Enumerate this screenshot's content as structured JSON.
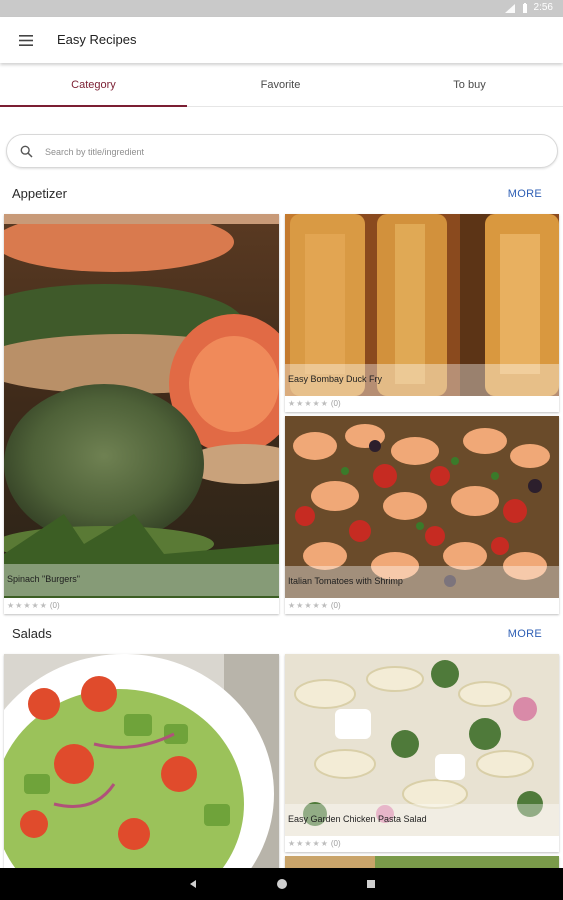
{
  "status": {
    "time": "2:56"
  },
  "app": {
    "title": "Easy Recipes"
  },
  "tabs": [
    {
      "label": "Category",
      "active": true
    },
    {
      "label": "Favorite",
      "active": false
    },
    {
      "label": "To buy",
      "active": false
    }
  ],
  "search": {
    "placeholder": "Search by title/ingredient",
    "value": ""
  },
  "sections": [
    {
      "title": "Appetizer",
      "more_label": "MORE",
      "recipes": [
        {
          "title": "Spinach \"Burgers\"",
          "rating_count": "(0)",
          "stars": "★★★★★"
        },
        {
          "title": "Easy Bombay Duck Fry",
          "rating_count": "(0)",
          "stars": "★★★★★"
        },
        {
          "title": "Italian Tomatoes with Shrimp",
          "rating_count": "(0)",
          "stars": "★★★★★"
        }
      ]
    },
    {
      "title": "Salads",
      "more_label": "MORE",
      "recipes": [
        {
          "title": "",
          "rating_count": "",
          "stars": ""
        },
        {
          "title": "Easy Garden Chicken Pasta Salad",
          "rating_count": "(0)",
          "stars": "★★★★★"
        }
      ]
    }
  ],
  "colors": {
    "accent": "#7b1e32",
    "link": "#2e5fb5",
    "status_bar": "#c9c9c9"
  },
  "icons": {
    "menu": "menu-icon",
    "search": "search-icon",
    "signal": "signal-icon",
    "battery": "battery-icon",
    "back": "back-icon",
    "home": "home-icon",
    "recents": "recents-icon"
  }
}
